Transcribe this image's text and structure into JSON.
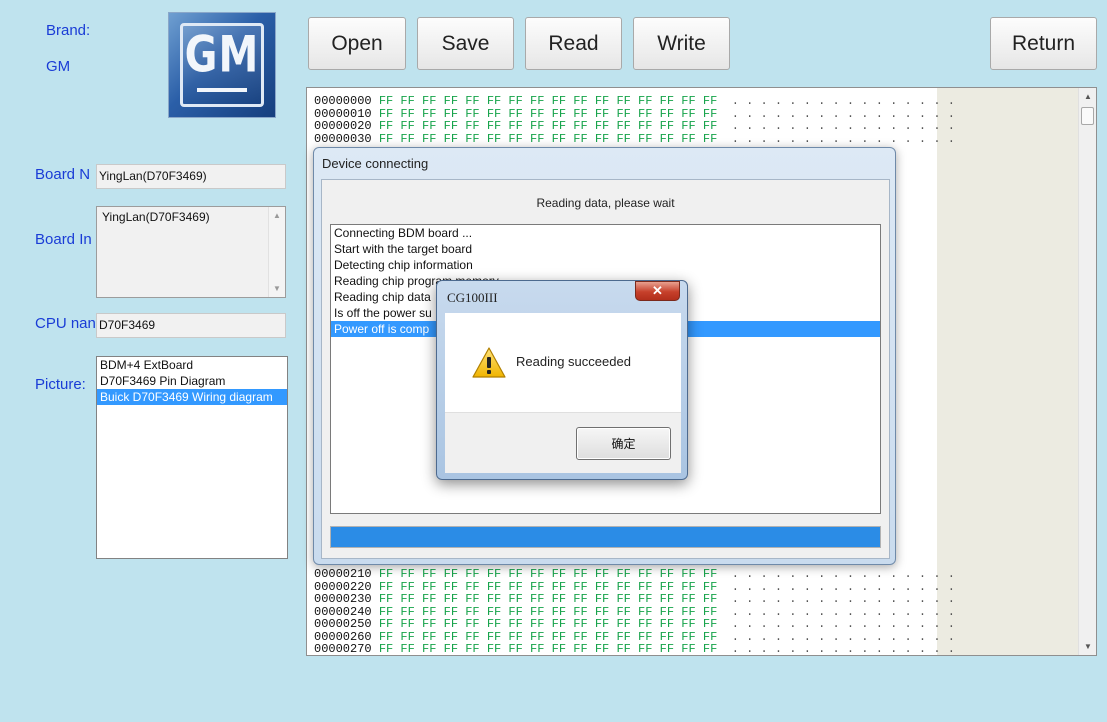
{
  "brand": {
    "label": "Brand:",
    "value": "GM",
    "logo_text": "GM"
  },
  "fields": {
    "board_name_label": "Board N",
    "board_name_value": "YingLan(D70F3469)",
    "board_info_label": "Board In",
    "board_info_value": "YingLan(D70F3469)",
    "cpu_name_label": "CPU nan",
    "cpu_name_value": "D70F3469",
    "picture_label": "Picture:"
  },
  "picture_list": [
    {
      "label": "BDM+4 ExtBoard",
      "selected": false
    },
    {
      "label": "D70F3469 Pin Diagram",
      "selected": false
    },
    {
      "label": "Buick D70F3469 Wiring diagram",
      "selected": true
    }
  ],
  "toolbar": {
    "open": "Open",
    "save": "Save",
    "read": "Read",
    "write": "Write",
    "return": "Return"
  },
  "hex": {
    "bytes_text": "FF FF FF FF FF FF FF FF FF FF FF FF FF FF FF FF",
    "ascii_text": ". . . . . . . . . . . . . . . .",
    "top_rows": [
      "00000000",
      "00000010",
      "00000020",
      "00000030"
    ],
    "bottom_rows": [
      "00000210",
      "00000220",
      "00000230",
      "00000240",
      "00000250",
      "00000260",
      "00000270"
    ]
  },
  "device_dialog": {
    "title": "Device connecting",
    "message": "Reading data, please wait",
    "log": [
      {
        "text": "Connecting BDM board ...",
        "selected": false
      },
      {
        "text": "Start with the target board",
        "selected": false
      },
      {
        "text": "Detecting chip information",
        "selected": false
      },
      {
        "text": "Reading chip program memory",
        "selected": false
      },
      {
        "text": "Reading chip data",
        "selected": false
      },
      {
        "text": "Is off the power su",
        "selected": false
      },
      {
        "text": "Power off is comp",
        "selected": true
      }
    ],
    "progress": 1.0,
    "progress_color": "#2b8ce6"
  },
  "message_box": {
    "title": "CG100III",
    "close_glyph": "✕",
    "icon": "warning-icon",
    "message": "Reading succeeded",
    "ok_label": "确定"
  },
  "colors": {
    "background": "#bfe3ee",
    "label_blue": "#1a3cd6",
    "hex_green": "#16a34a",
    "selection": "#3399ff"
  }
}
